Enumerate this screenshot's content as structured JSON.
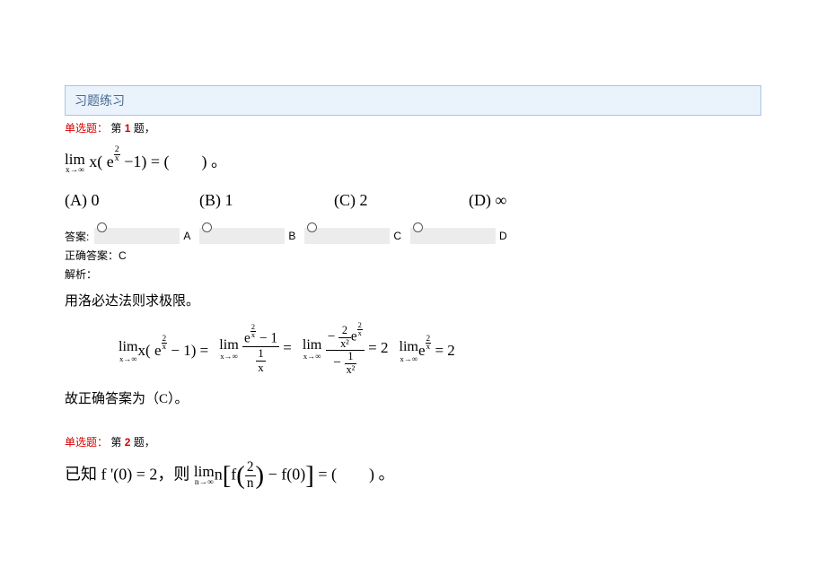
{
  "header": {
    "title": "习题练习"
  },
  "q1": {
    "type_label": "单选题：",
    "prefix": "第 ",
    "number": "1",
    "suffix": " 题，",
    "problem_prefix": "",
    "lim_top": "lim",
    "lim_bot": "x→∞",
    "expr_left": "x( e",
    "expr_exp_num": "2",
    "expr_exp_den": "x",
    "expr_right": " −1) = (　　) 。",
    "choices": {
      "A": {
        "label": "(A) 0"
      },
      "B": {
        "label": "(B) 1"
      },
      "C": {
        "label": "(C) 2"
      },
      "D": {
        "label": "(D) ∞"
      }
    },
    "answer_label": "答案:",
    "opts": {
      "A": "A",
      "B": "B",
      "C": "C",
      "D": "D"
    },
    "correct_label": "正确答案：",
    "correct_value": "C",
    "solution_label": "解析：",
    "solution_text": "用洛必达法则求极限。",
    "solution_math": {
      "lim": "lim",
      "sub": "x→∞",
      "p1a": "x( e",
      "p1_exp_n": "2",
      "p1_exp_d": "x",
      "p1b": " − 1)  =  ",
      "f2num_a": "e",
      "f2num_exp_n": "2",
      "f2num_exp_d": "x",
      "f2num_b": " − 1",
      "f2den_n": "1",
      "f2den_d": "x",
      "eq2": "  =  ",
      "f3num_a": "− ",
      "f3num_fr_n": "2",
      "f3num_fr_d": "x²",
      "f3num_b": "e",
      "f3num_exp_n": "2",
      "f3num_exp_d": "x",
      "f3den_a": "− ",
      "f3den_n": "1",
      "f3den_d": "x²",
      "eq3": "  =  2 ",
      "p4a": "e",
      "p4_exp_n": "2",
      "p4_exp_d": "x",
      "eq4": "  =  2"
    },
    "solution_conclusion": "故正确答案为（C）。"
  },
  "q2": {
    "type_label": "单选题：",
    "prefix": "第 ",
    "number": "2",
    "suffix": " 题，",
    "pre": "已知 f '(0) = 2，则",
    "lim_top": "lim",
    "lim_bot": "n→∞",
    "n_before": "n",
    "f_open": "f",
    "inner_n": "2",
    "inner_d": "n",
    "minus": " − f(0)",
    "tail": " = (　　) 。"
  }
}
